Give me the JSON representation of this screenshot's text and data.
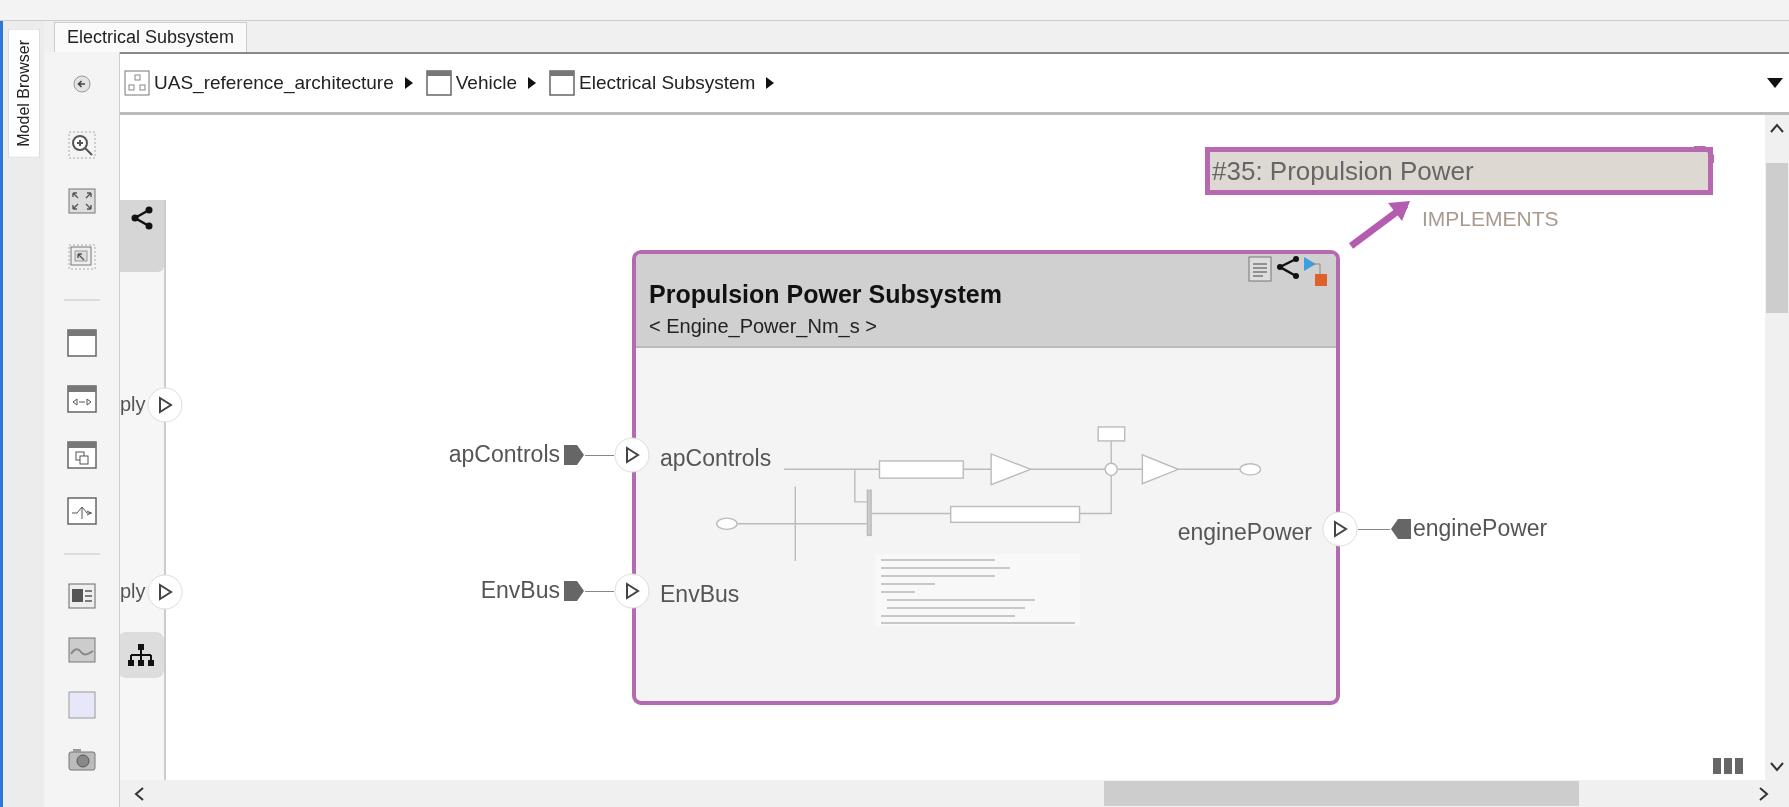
{
  "side_tab": {
    "label": "Model Browser"
  },
  "tab": {
    "label": "Electrical Subsystem",
    "selected": true
  },
  "breadcrumb": [
    {
      "label": "UAS_reference_architecture",
      "kind": "model"
    },
    {
      "label": "Vehicle",
      "kind": "component"
    },
    {
      "label": "Electrical Subsystem",
      "kind": "component"
    }
  ],
  "requirement": {
    "label": "#35: Propulsion Power",
    "link": "IMPLEMENTS"
  },
  "partial_ports": [
    {
      "label": "ply"
    },
    {
      "label": "ply"
    }
  ],
  "component": {
    "name": "Propulsion Power Subsystem",
    "stereotype": "< Engine_Power_Nm_s >",
    "ports": [
      {
        "label": "apControls",
        "kind": "input",
        "external_label": "apControls"
      },
      {
        "label": "EnvBus",
        "kind": "input",
        "external_label": "EnvBus"
      },
      {
        "label": "enginePower",
        "kind": "output",
        "external_label": "enginePower"
      }
    ]
  }
}
